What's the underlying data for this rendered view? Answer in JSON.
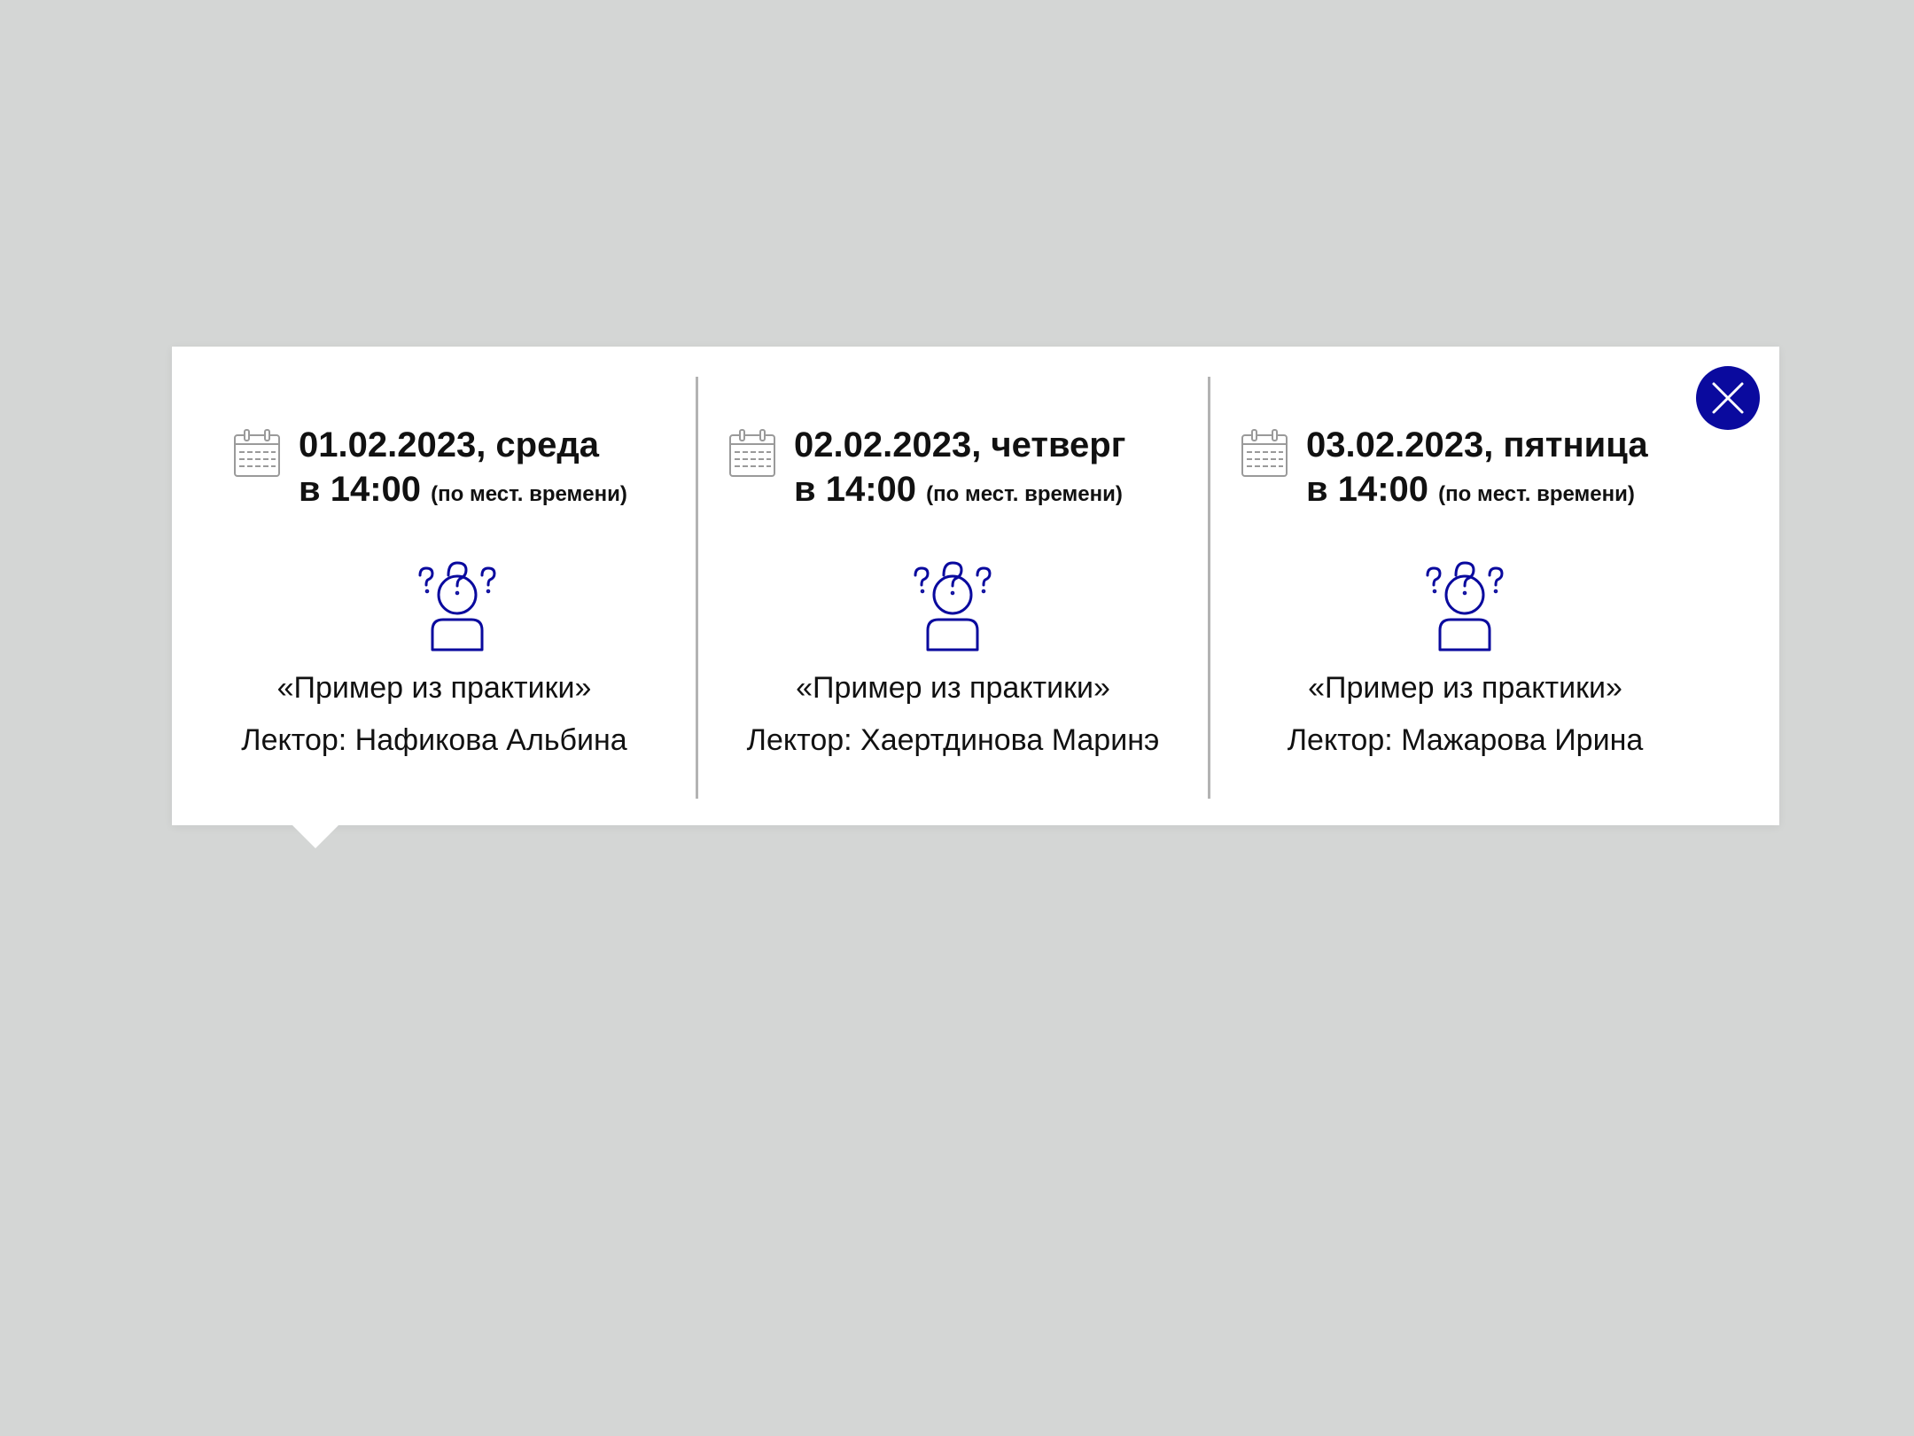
{
  "colors": {
    "page_background": "#d4d6d5",
    "card_background": "#ffffff",
    "accent": "#0a0a9e",
    "divider": "#b3b3b3",
    "text": "#111111",
    "calendar_icon": "#9a9a9a"
  },
  "close_button": {
    "icon": "close-icon"
  },
  "events": [
    {
      "date": "01.02.2023, среда",
      "time": "в 14:00",
      "time_note": "(по мест. времени)",
      "icon": "person-question-icon",
      "topic": "«Пример из практики»",
      "lector": "Лектор: Нафикова Альбина"
    },
    {
      "date": "02.02.2023, четверг",
      "time": "в 14:00",
      "time_note": "(по мест. времени)",
      "icon": "person-question-icon",
      "topic": "«Пример из практики»",
      "lector": "Лектор: Хаертдинова Маринэ"
    },
    {
      "date": "03.02.2023, пятница",
      "time": "в 14:00",
      "time_note": "(по мест. времени)",
      "icon": "person-question-icon",
      "topic": "«Пример из практики»",
      "lector": "Лектор: Мажарова Ирина"
    }
  ]
}
